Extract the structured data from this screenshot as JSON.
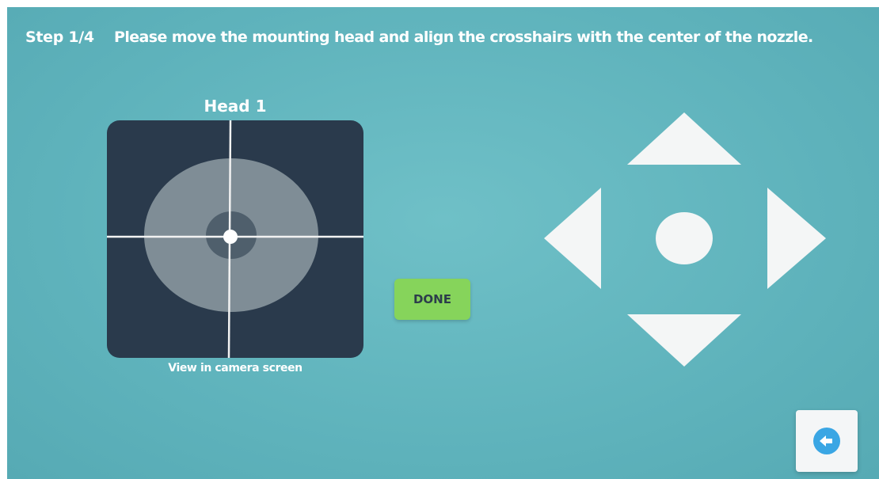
{
  "header": {
    "step": "Step 1/4",
    "instruction": "Please move the mounting head and align the crosshairs with the center of the nozzle."
  },
  "camera_panel": {
    "title": "Head 1",
    "caption": "View in camera screen"
  },
  "actions": {
    "done_label": "DONE"
  },
  "dpad": {
    "up_icon": "triangle-up-icon",
    "down_icon": "triangle-down-icon",
    "left_icon": "triangle-left-icon",
    "right_icon": "triangle-right-icon",
    "center_icon": "circle-icon"
  },
  "back_icon": "arrow-left-icon",
  "colors": {
    "background": "#5fb3bc",
    "camera_bg": "#2a3a4c",
    "done_button": "#86d45b",
    "back_button_accent": "#3aa6e4"
  }
}
